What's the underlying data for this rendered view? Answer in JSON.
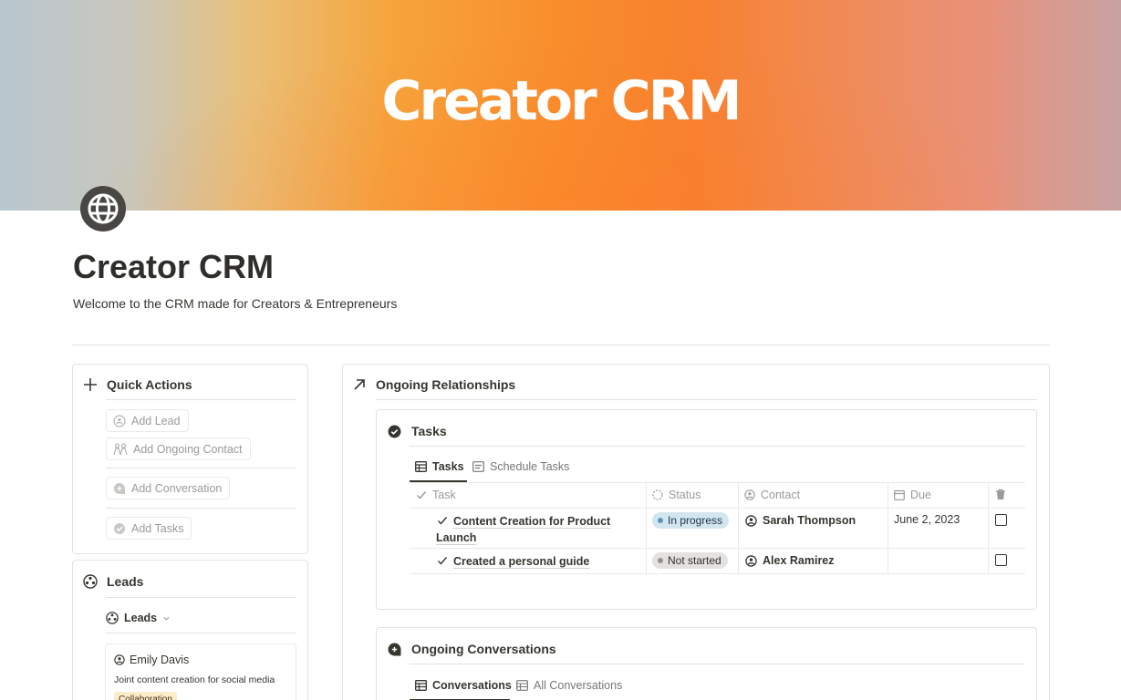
{
  "cover": {
    "title": "Creator CRM"
  },
  "page": {
    "title": "Creator CRM",
    "subtitle": "Welcome to the CRM made for Creators & Entrepreneurs",
    "icon": "globe-icon"
  },
  "quick_actions": {
    "title": "Quick Actions",
    "buttons": [
      {
        "label": "Add Lead",
        "icon": "lead-icon"
      },
      {
        "label": "Add Ongoing Contact",
        "icon": "people-icon"
      },
      {
        "label": "Add Conversation",
        "icon": "chat-icon"
      },
      {
        "label": "Add Tasks",
        "icon": "check-circle-icon"
      }
    ]
  },
  "leads": {
    "title": "Leads",
    "view_label": "Leads",
    "card": {
      "name": "Emily Davis",
      "description": "Joint content creation for social media",
      "tag": "Collaboration"
    }
  },
  "relationships": {
    "title": "Ongoing Relationships",
    "tasks": {
      "title": "Tasks",
      "tabs": [
        "Tasks",
        "Schedule Tasks"
      ],
      "columns": [
        "Task",
        "Status",
        "Contact",
        "Due"
      ],
      "rows": [
        {
          "task_line1": "Content Creation for Product",
          "task_line2": "Launch",
          "status": "In progress",
          "contact": "Sarah Thompson",
          "due": "June 2, 2023",
          "done": false
        },
        {
          "task_line1": "Created a personal guide",
          "task_line2": "",
          "status": "Not started",
          "contact": "Alex Ramirez",
          "due": "",
          "done": false
        }
      ]
    },
    "conversations": {
      "title": "Ongoing Conversations",
      "tabs": [
        "Conversations",
        "All Conversations"
      ]
    }
  },
  "colors": {
    "in_progress_bg": "#d3e5ef",
    "in_progress_dot": "#5b97bd",
    "not_started_bg": "#e3e2e0",
    "not_started_dot": "#91918e",
    "tag_bg": "#fdecc8"
  }
}
